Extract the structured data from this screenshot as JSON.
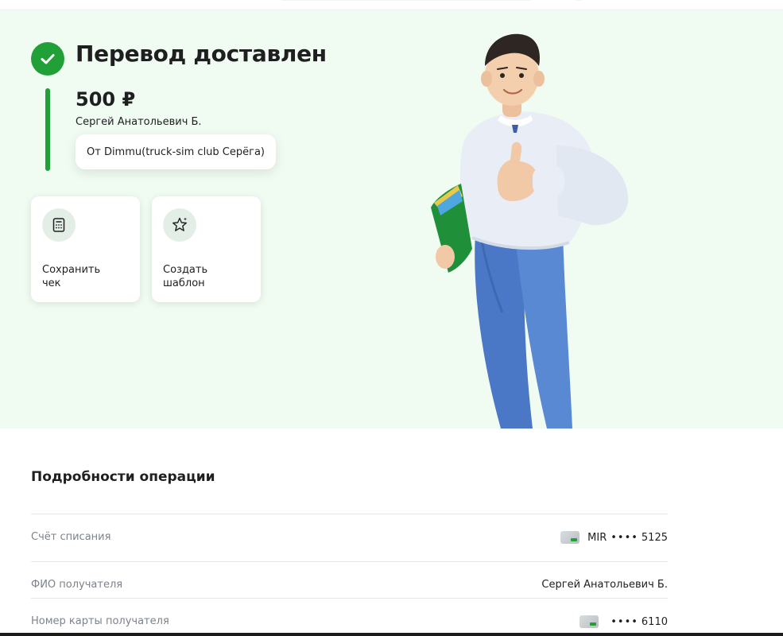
{
  "status": {
    "title": "Перевод доставлен",
    "icon": "check-icon",
    "color": "#21a038"
  },
  "transfer": {
    "amount": "500 ₽",
    "recipient": "Сергей Анатольевич Б.",
    "message": "От Dimmu(truck-sim club Серёга)"
  },
  "actions": [
    {
      "label": "Сохранить\nчек",
      "icon": "receipt-icon"
    },
    {
      "label": "Создать\nшаблон",
      "icon": "star-template-icon"
    }
  ],
  "details": {
    "title": "Подробности операции",
    "rows": [
      {
        "label": "Счёт списания",
        "value_prefix": "MIR",
        "masked": "••••",
        "value": "5125",
        "icon": "bank-card-icon"
      },
      {
        "label": "ФИО получателя",
        "value": "Сергей Анатольевич Б."
      },
      {
        "label": "Номер карты получателя",
        "masked": "••••",
        "value": "6110",
        "icon": "bank-card-icon"
      }
    ]
  },
  "colors": {
    "hero_background": "#f0fbf1",
    "accent": "#21a038",
    "muted_text": "#7d838a"
  }
}
